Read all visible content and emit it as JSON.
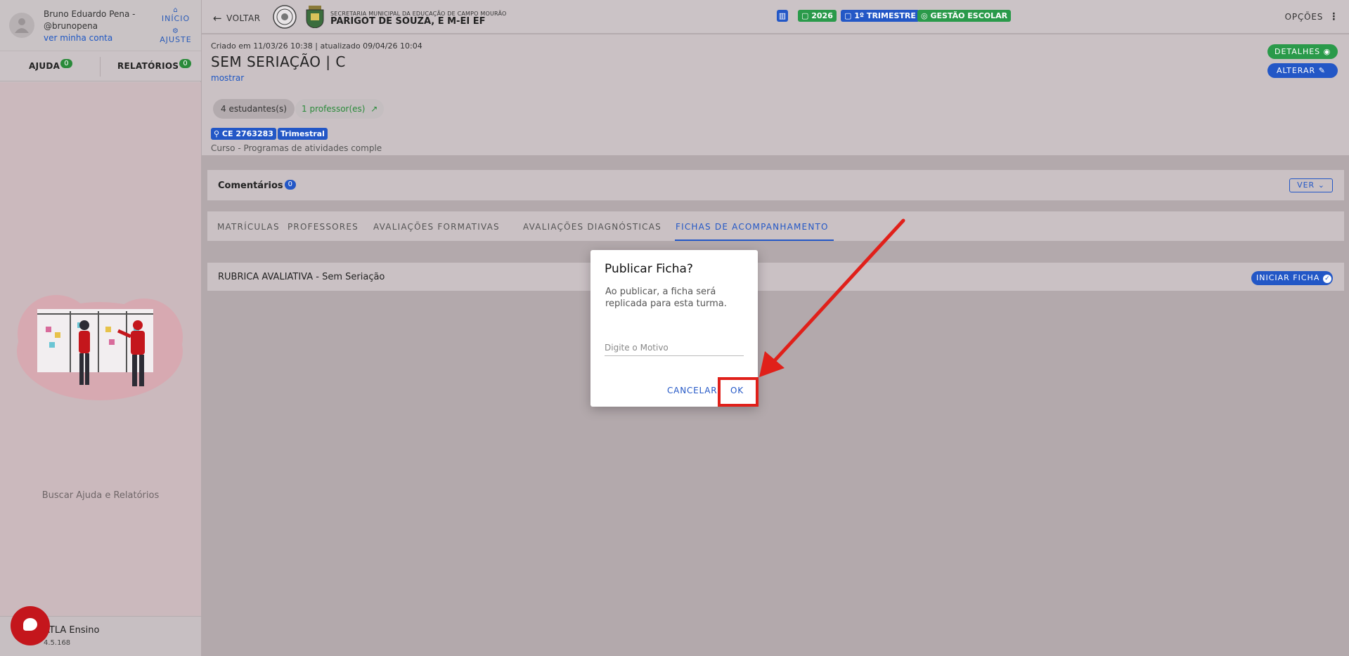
{
  "sidebar": {
    "user_name": "Bruno Eduardo Pena - @brunopena",
    "account_link": "ver minha conta",
    "nav_inicio": "INÍCIO",
    "nav_ajuste": "AJUSTE",
    "tabs": [
      {
        "label": "AJUDA",
        "count": "0"
      },
      {
        "label": "RELATÓRIOS",
        "count": "0"
      }
    ],
    "help_text": "Buscar Ajuda e Relatórios",
    "app_name": "ATLA Ensino",
    "app_version": "4.5.168"
  },
  "header": {
    "back_label": "VOLTAR",
    "secretaria": "SECRETARIA MUNICIPAL DA EDUCAÇÃO DE CAMPO MOURÃO",
    "school": "PARIGOT DE SOUZA, E M-EI EF",
    "chip_year": "2026",
    "chip_term": "1º TRIMESTRE",
    "chip_mode": "GESTÃO ESCOLAR",
    "options": "OPÇÕES"
  },
  "class_info": {
    "created": "Criado em 11/03/26 10:38 | atualizado 09/04/26 10:04",
    "title": "SEM SERIAÇÃO | C",
    "show_link": "mostrar",
    "students": "4 estudantes(s)",
    "professors": "1 professor(es)",
    "tag_ce": "CE 2763283",
    "tag_period": "Trimestral",
    "course": "Curso - Programas de atividades comple",
    "btn_details": "DETALHES",
    "btn_alter": "ALTERAR"
  },
  "comments": {
    "label": "Comentários",
    "count": "0",
    "ver": "VER"
  },
  "tabs": [
    "MATRÍCULAS",
    "PROFESSORES",
    "AVALIAÇÕES FORMATIVAS",
    "AVALIAÇÕES DIAGNÓSTICAS",
    "FICHAS DE ACOMPANHAMENTO"
  ],
  "rubric": {
    "label": "RUBRICA AVALIATIVA - Sem Seriação",
    "btn": "INICIAR FICHA"
  },
  "dialog": {
    "title": "Publicar Ficha?",
    "body": "Ao publicar, a ficha será replicada para esta turma.",
    "input_placeholder": "Digite o Motivo",
    "cancel": "CANCELAR",
    "ok": "OK"
  },
  "colors": {
    "primary": "#2357c6",
    "success": "#2a9a4a",
    "annotation": "#e0201a",
    "fab": "#c4161c"
  }
}
